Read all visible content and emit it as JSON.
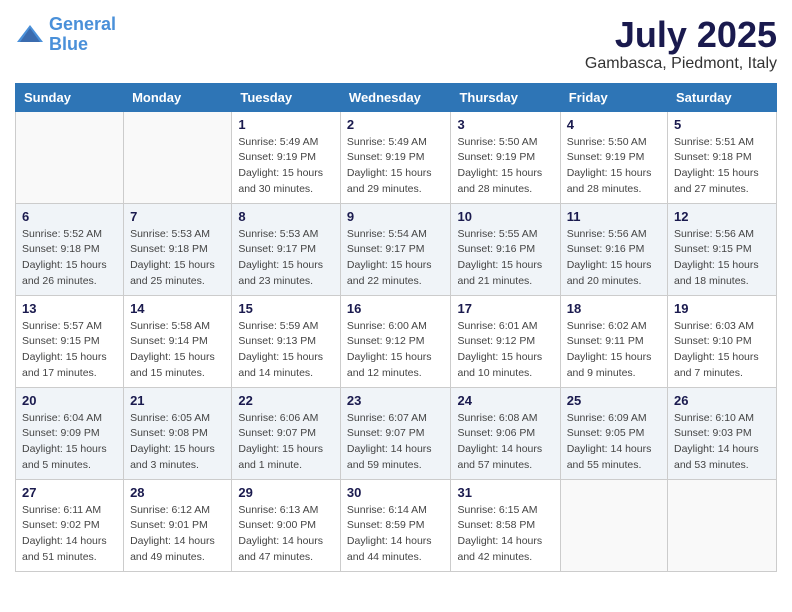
{
  "header": {
    "logo_line1": "General",
    "logo_line2": "Blue",
    "month": "July 2025",
    "location": "Gambasca, Piedmont, Italy"
  },
  "weekdays": [
    "Sunday",
    "Monday",
    "Tuesday",
    "Wednesday",
    "Thursday",
    "Friday",
    "Saturday"
  ],
  "weeks": [
    [
      {
        "day": "",
        "info": ""
      },
      {
        "day": "",
        "info": ""
      },
      {
        "day": "1",
        "info": "Sunrise: 5:49 AM\nSunset: 9:19 PM\nDaylight: 15 hours\nand 30 minutes."
      },
      {
        "day": "2",
        "info": "Sunrise: 5:49 AM\nSunset: 9:19 PM\nDaylight: 15 hours\nand 29 minutes."
      },
      {
        "day": "3",
        "info": "Sunrise: 5:50 AM\nSunset: 9:19 PM\nDaylight: 15 hours\nand 28 minutes."
      },
      {
        "day": "4",
        "info": "Sunrise: 5:50 AM\nSunset: 9:19 PM\nDaylight: 15 hours\nand 28 minutes."
      },
      {
        "day": "5",
        "info": "Sunrise: 5:51 AM\nSunset: 9:18 PM\nDaylight: 15 hours\nand 27 minutes."
      }
    ],
    [
      {
        "day": "6",
        "info": "Sunrise: 5:52 AM\nSunset: 9:18 PM\nDaylight: 15 hours\nand 26 minutes."
      },
      {
        "day": "7",
        "info": "Sunrise: 5:53 AM\nSunset: 9:18 PM\nDaylight: 15 hours\nand 25 minutes."
      },
      {
        "day": "8",
        "info": "Sunrise: 5:53 AM\nSunset: 9:17 PM\nDaylight: 15 hours\nand 23 minutes."
      },
      {
        "day": "9",
        "info": "Sunrise: 5:54 AM\nSunset: 9:17 PM\nDaylight: 15 hours\nand 22 minutes."
      },
      {
        "day": "10",
        "info": "Sunrise: 5:55 AM\nSunset: 9:16 PM\nDaylight: 15 hours\nand 21 minutes."
      },
      {
        "day": "11",
        "info": "Sunrise: 5:56 AM\nSunset: 9:16 PM\nDaylight: 15 hours\nand 20 minutes."
      },
      {
        "day": "12",
        "info": "Sunrise: 5:56 AM\nSunset: 9:15 PM\nDaylight: 15 hours\nand 18 minutes."
      }
    ],
    [
      {
        "day": "13",
        "info": "Sunrise: 5:57 AM\nSunset: 9:15 PM\nDaylight: 15 hours\nand 17 minutes."
      },
      {
        "day": "14",
        "info": "Sunrise: 5:58 AM\nSunset: 9:14 PM\nDaylight: 15 hours\nand 15 minutes."
      },
      {
        "day": "15",
        "info": "Sunrise: 5:59 AM\nSunset: 9:13 PM\nDaylight: 15 hours\nand 14 minutes."
      },
      {
        "day": "16",
        "info": "Sunrise: 6:00 AM\nSunset: 9:12 PM\nDaylight: 15 hours\nand 12 minutes."
      },
      {
        "day": "17",
        "info": "Sunrise: 6:01 AM\nSunset: 9:12 PM\nDaylight: 15 hours\nand 10 minutes."
      },
      {
        "day": "18",
        "info": "Sunrise: 6:02 AM\nSunset: 9:11 PM\nDaylight: 15 hours\nand 9 minutes."
      },
      {
        "day": "19",
        "info": "Sunrise: 6:03 AM\nSunset: 9:10 PM\nDaylight: 15 hours\nand 7 minutes."
      }
    ],
    [
      {
        "day": "20",
        "info": "Sunrise: 6:04 AM\nSunset: 9:09 PM\nDaylight: 15 hours\nand 5 minutes."
      },
      {
        "day": "21",
        "info": "Sunrise: 6:05 AM\nSunset: 9:08 PM\nDaylight: 15 hours\nand 3 minutes."
      },
      {
        "day": "22",
        "info": "Sunrise: 6:06 AM\nSunset: 9:07 PM\nDaylight: 15 hours\nand 1 minute."
      },
      {
        "day": "23",
        "info": "Sunrise: 6:07 AM\nSunset: 9:07 PM\nDaylight: 14 hours\nand 59 minutes."
      },
      {
        "day": "24",
        "info": "Sunrise: 6:08 AM\nSunset: 9:06 PM\nDaylight: 14 hours\nand 57 minutes."
      },
      {
        "day": "25",
        "info": "Sunrise: 6:09 AM\nSunset: 9:05 PM\nDaylight: 14 hours\nand 55 minutes."
      },
      {
        "day": "26",
        "info": "Sunrise: 6:10 AM\nSunset: 9:03 PM\nDaylight: 14 hours\nand 53 minutes."
      }
    ],
    [
      {
        "day": "27",
        "info": "Sunrise: 6:11 AM\nSunset: 9:02 PM\nDaylight: 14 hours\nand 51 minutes."
      },
      {
        "day": "28",
        "info": "Sunrise: 6:12 AM\nSunset: 9:01 PM\nDaylight: 14 hours\nand 49 minutes."
      },
      {
        "day": "29",
        "info": "Sunrise: 6:13 AM\nSunset: 9:00 PM\nDaylight: 14 hours\nand 47 minutes."
      },
      {
        "day": "30",
        "info": "Sunrise: 6:14 AM\nSunset: 8:59 PM\nDaylight: 14 hours\nand 44 minutes."
      },
      {
        "day": "31",
        "info": "Sunrise: 6:15 AM\nSunset: 8:58 PM\nDaylight: 14 hours\nand 42 minutes."
      },
      {
        "day": "",
        "info": ""
      },
      {
        "day": "",
        "info": ""
      }
    ]
  ]
}
